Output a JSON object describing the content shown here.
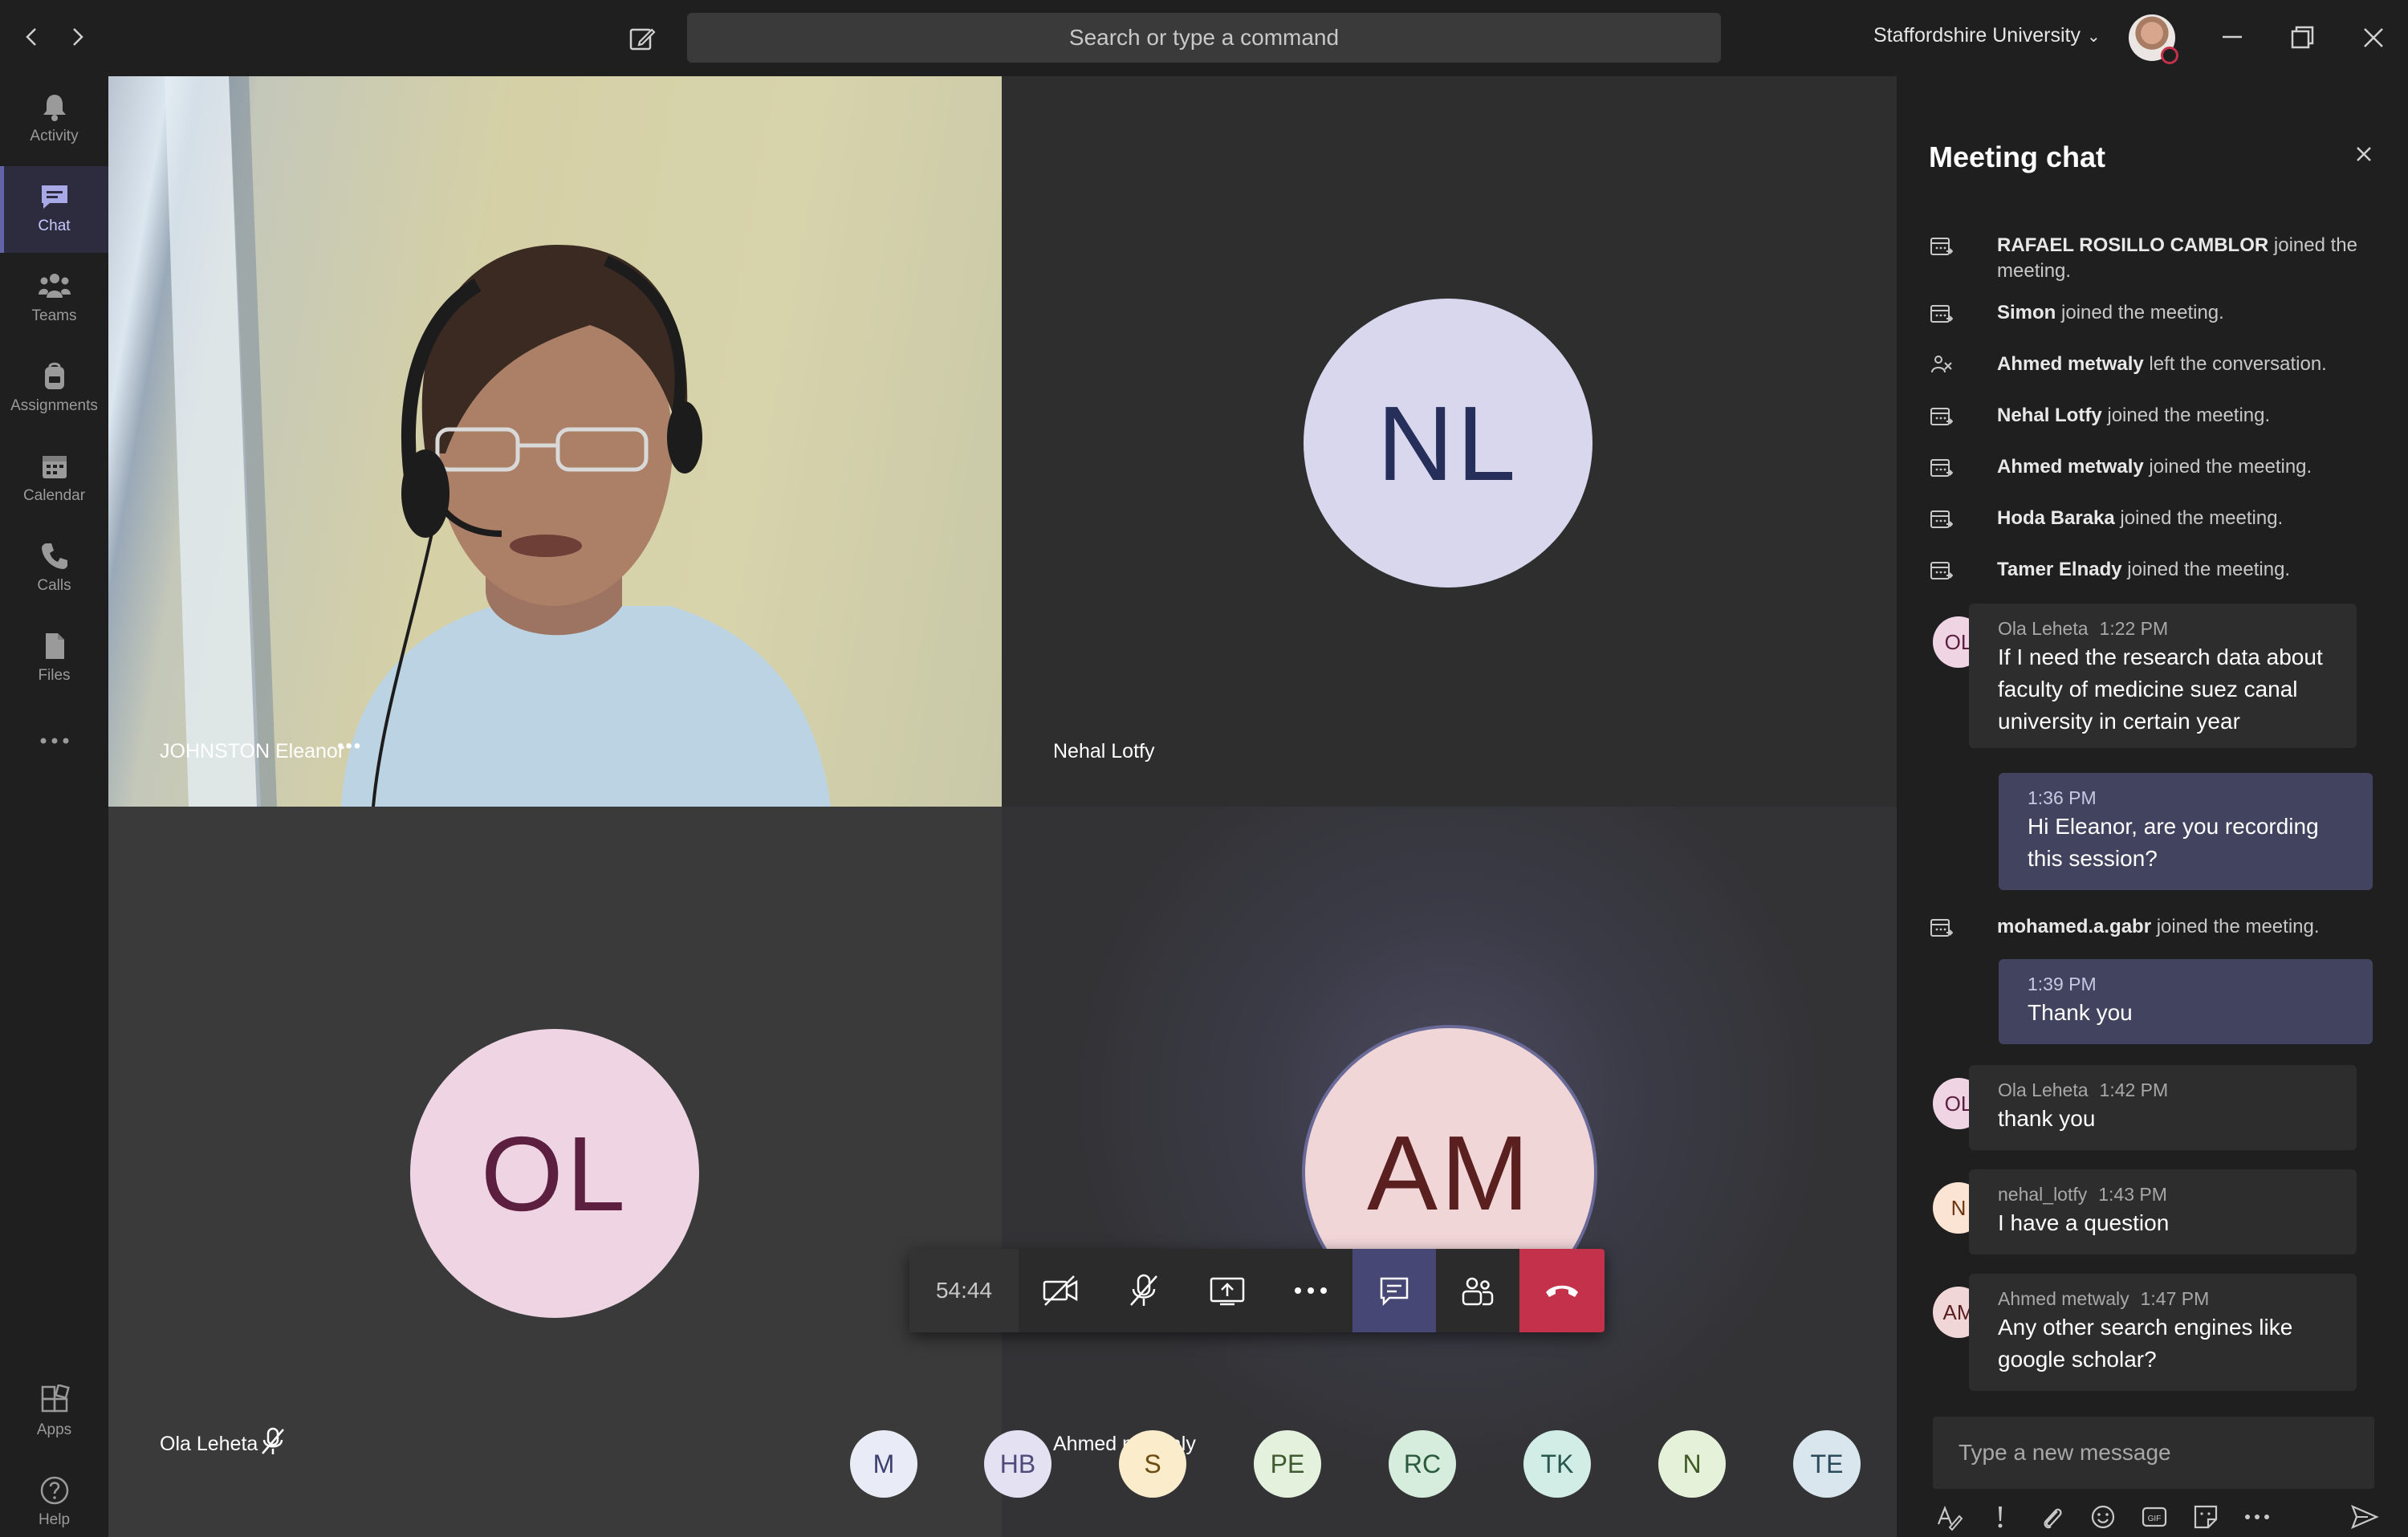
{
  "titlebar": {
    "back_icon": "chevron-left-icon",
    "forward_icon": "chevron-right-icon",
    "compose_icon": "compose-icon",
    "search_placeholder": "Search or type a command",
    "org_name": "Staffordshire University",
    "org_chevron": "⌄",
    "window_buttons": [
      "minimize-icon",
      "restore-icon",
      "close-icon"
    ]
  },
  "rail": {
    "items": [
      {
        "label": "Activity",
        "icon": "bell-icon"
      },
      {
        "label": "Chat",
        "icon": "chat-icon"
      },
      {
        "label": "Teams",
        "icon": "teams-icon"
      },
      {
        "label": "Assignments",
        "icon": "backpack-icon"
      },
      {
        "label": "Calendar",
        "icon": "calendar-icon"
      },
      {
        "label": "Calls",
        "icon": "phone-icon"
      },
      {
        "label": "Files",
        "icon": "file-icon"
      },
      {
        "label": "",
        "icon": "more-icon"
      }
    ],
    "active": "Chat",
    "bottom": [
      {
        "label": "Apps",
        "icon": "apps-icon"
      },
      {
        "label": "Help",
        "icon": "help-icon"
      }
    ]
  },
  "tiles": {
    "t1": {
      "name": "JOHNSTON Eleanor",
      "more": "•••"
    },
    "t2": {
      "name": "Nehal Lotfy",
      "initials": "NL"
    },
    "t3": {
      "name": "Ola Leheta",
      "initials": "OL",
      "muted_icon": "mic-off-icon"
    },
    "t4": {
      "name": "Ahmed metwaly",
      "initials": "AM"
    }
  },
  "controls": {
    "timer": "54:44",
    "buttons": [
      "camera-off-icon",
      "mic-off-icon",
      "share-screen-icon",
      "more-icon",
      "chat-icon",
      "participants-icon",
      "hangup-icon"
    ]
  },
  "participants": [
    {
      "initials": "M",
      "bg": "#e9ebf7",
      "fg": "#3d3f6e"
    },
    {
      "initials": "HB",
      "bg": "#e4e1f3",
      "fg": "#4f4a7a"
    },
    {
      "initials": "S",
      "bg": "#fbeccc",
      "fg": "#6b4b10"
    },
    {
      "initials": "PE",
      "bg": "#e4f1dd",
      "fg": "#3f5a30"
    },
    {
      "initials": "RC",
      "bg": "#d6ecdd",
      "fg": "#2c5a3c"
    },
    {
      "initials": "TK",
      "bg": "#d2ece6",
      "fg": "#27584c"
    },
    {
      "initials": "N",
      "bg": "#e5f1d8",
      "fg": "#3f5a24"
    },
    {
      "initials": "TE",
      "bg": "#d9e6ee",
      "fg": "#2b4a5c"
    }
  ],
  "chat": {
    "title": "Meeting chat",
    "system": [
      {
        "name": "RAFAEL ROSILLO CAMBLOR",
        "text": " joined the meeting.",
        "icon": "join-icon"
      },
      {
        "name": "Simon",
        "text": " joined the meeting.",
        "icon": "join-icon"
      },
      {
        "name": "Ahmed metwaly",
        "text": " left the conversation.",
        "icon": "leave-icon"
      },
      {
        "name": "Nehal Lotfy",
        "text": " joined the meeting.",
        "icon": "join-icon"
      },
      {
        "name": "Ahmed metwaly",
        "text": " joined the meeting.",
        "icon": "join-icon"
      },
      {
        "name": "Hoda Baraka",
        "text": " joined the meeting.",
        "icon": "join-icon"
      },
      {
        "name": "Tamer Elnady",
        "text": " joined the meeting.",
        "icon": "join-icon"
      },
      {
        "name": "mohamed.a.gabr",
        "text": " joined the meeting.",
        "icon": "join-icon"
      }
    ],
    "messages": [
      {
        "initials": "OL",
        "author": "Ola Leheta",
        "time": "1:22 PM",
        "text": "If I need the research data about faculty of medicine suez canal university in certain year"
      },
      {
        "author": "",
        "time": "1:36 PM",
        "text": "Hi  Eleanor, are you recording this session?"
      },
      {
        "author": "",
        "time": "1:39 PM",
        "text": "Thank you"
      },
      {
        "initials": "OL",
        "author": "Ola Leheta",
        "time": "1:42 PM",
        "text": "thank you"
      },
      {
        "initials": "N",
        "author": "nehal_lotfy",
        "time": "1:43 PM",
        "text": "I have a question"
      },
      {
        "initials": "AM",
        "author": "Ahmed metwaly",
        "time": "1:47 PM",
        "text": "Any other search engines like google scholar?"
      }
    ],
    "compose_placeholder": "Type a new message",
    "tools": [
      "format-icon",
      "important-icon",
      "attach-icon",
      "emoji-icon",
      "gif-icon",
      "sticker-icon",
      "more-icon",
      "send-icon"
    ],
    "gif_label": "GIF"
  },
  "colors": {
    "accent": "#6264a7",
    "hangup": "#c4314b",
    "my_bubble": "#42445f"
  }
}
